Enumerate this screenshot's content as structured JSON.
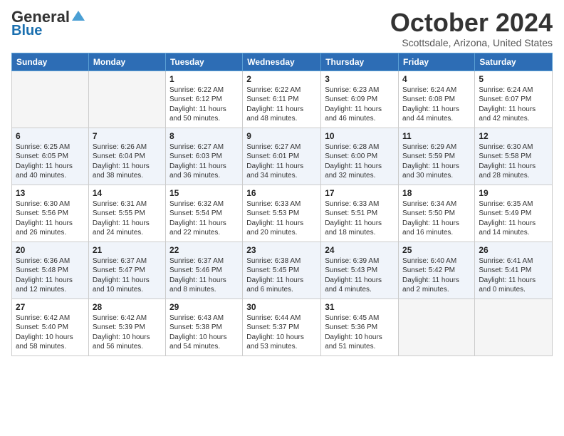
{
  "header": {
    "logo_general": "General",
    "logo_blue": "Blue",
    "month_title": "October 2024",
    "location": "Scottsdale, Arizona, United States"
  },
  "days_of_week": [
    "Sunday",
    "Monday",
    "Tuesday",
    "Wednesday",
    "Thursday",
    "Friday",
    "Saturday"
  ],
  "weeks": [
    [
      {
        "day": "",
        "info": ""
      },
      {
        "day": "",
        "info": ""
      },
      {
        "day": "1",
        "info": "Sunrise: 6:22 AM\nSunset: 6:12 PM\nDaylight: 11 hours and 50 minutes."
      },
      {
        "day": "2",
        "info": "Sunrise: 6:22 AM\nSunset: 6:11 PM\nDaylight: 11 hours and 48 minutes."
      },
      {
        "day": "3",
        "info": "Sunrise: 6:23 AM\nSunset: 6:09 PM\nDaylight: 11 hours and 46 minutes."
      },
      {
        "day": "4",
        "info": "Sunrise: 6:24 AM\nSunset: 6:08 PM\nDaylight: 11 hours and 44 minutes."
      },
      {
        "day": "5",
        "info": "Sunrise: 6:24 AM\nSunset: 6:07 PM\nDaylight: 11 hours and 42 minutes."
      }
    ],
    [
      {
        "day": "6",
        "info": "Sunrise: 6:25 AM\nSunset: 6:05 PM\nDaylight: 11 hours and 40 minutes."
      },
      {
        "day": "7",
        "info": "Sunrise: 6:26 AM\nSunset: 6:04 PM\nDaylight: 11 hours and 38 minutes."
      },
      {
        "day": "8",
        "info": "Sunrise: 6:27 AM\nSunset: 6:03 PM\nDaylight: 11 hours and 36 minutes."
      },
      {
        "day": "9",
        "info": "Sunrise: 6:27 AM\nSunset: 6:01 PM\nDaylight: 11 hours and 34 minutes."
      },
      {
        "day": "10",
        "info": "Sunrise: 6:28 AM\nSunset: 6:00 PM\nDaylight: 11 hours and 32 minutes."
      },
      {
        "day": "11",
        "info": "Sunrise: 6:29 AM\nSunset: 5:59 PM\nDaylight: 11 hours and 30 minutes."
      },
      {
        "day": "12",
        "info": "Sunrise: 6:30 AM\nSunset: 5:58 PM\nDaylight: 11 hours and 28 minutes."
      }
    ],
    [
      {
        "day": "13",
        "info": "Sunrise: 6:30 AM\nSunset: 5:56 PM\nDaylight: 11 hours and 26 minutes."
      },
      {
        "day": "14",
        "info": "Sunrise: 6:31 AM\nSunset: 5:55 PM\nDaylight: 11 hours and 24 minutes."
      },
      {
        "day": "15",
        "info": "Sunrise: 6:32 AM\nSunset: 5:54 PM\nDaylight: 11 hours and 22 minutes."
      },
      {
        "day": "16",
        "info": "Sunrise: 6:33 AM\nSunset: 5:53 PM\nDaylight: 11 hours and 20 minutes."
      },
      {
        "day": "17",
        "info": "Sunrise: 6:33 AM\nSunset: 5:51 PM\nDaylight: 11 hours and 18 minutes."
      },
      {
        "day": "18",
        "info": "Sunrise: 6:34 AM\nSunset: 5:50 PM\nDaylight: 11 hours and 16 minutes."
      },
      {
        "day": "19",
        "info": "Sunrise: 6:35 AM\nSunset: 5:49 PM\nDaylight: 11 hours and 14 minutes."
      }
    ],
    [
      {
        "day": "20",
        "info": "Sunrise: 6:36 AM\nSunset: 5:48 PM\nDaylight: 11 hours and 12 minutes."
      },
      {
        "day": "21",
        "info": "Sunrise: 6:37 AM\nSunset: 5:47 PM\nDaylight: 11 hours and 10 minutes."
      },
      {
        "day": "22",
        "info": "Sunrise: 6:37 AM\nSunset: 5:46 PM\nDaylight: 11 hours and 8 minutes."
      },
      {
        "day": "23",
        "info": "Sunrise: 6:38 AM\nSunset: 5:45 PM\nDaylight: 11 hours and 6 minutes."
      },
      {
        "day": "24",
        "info": "Sunrise: 6:39 AM\nSunset: 5:43 PM\nDaylight: 11 hours and 4 minutes."
      },
      {
        "day": "25",
        "info": "Sunrise: 6:40 AM\nSunset: 5:42 PM\nDaylight: 11 hours and 2 minutes."
      },
      {
        "day": "26",
        "info": "Sunrise: 6:41 AM\nSunset: 5:41 PM\nDaylight: 11 hours and 0 minutes."
      }
    ],
    [
      {
        "day": "27",
        "info": "Sunrise: 6:42 AM\nSunset: 5:40 PM\nDaylight: 10 hours and 58 minutes."
      },
      {
        "day": "28",
        "info": "Sunrise: 6:42 AM\nSunset: 5:39 PM\nDaylight: 10 hours and 56 minutes."
      },
      {
        "day": "29",
        "info": "Sunrise: 6:43 AM\nSunset: 5:38 PM\nDaylight: 10 hours and 54 minutes."
      },
      {
        "day": "30",
        "info": "Sunrise: 6:44 AM\nSunset: 5:37 PM\nDaylight: 10 hours and 53 minutes."
      },
      {
        "day": "31",
        "info": "Sunrise: 6:45 AM\nSunset: 5:36 PM\nDaylight: 10 hours and 51 minutes."
      },
      {
        "day": "",
        "info": ""
      },
      {
        "day": "",
        "info": ""
      }
    ]
  ]
}
